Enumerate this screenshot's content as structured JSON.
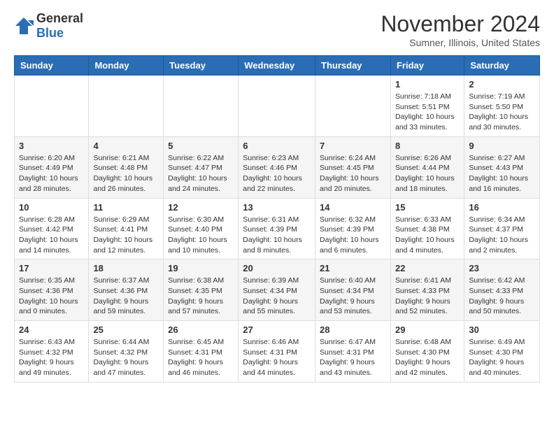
{
  "header": {
    "logo_general": "General",
    "logo_blue": "Blue",
    "month_title": "November 2024",
    "location": "Sumner, Illinois, United States"
  },
  "days_of_week": [
    "Sunday",
    "Monday",
    "Tuesday",
    "Wednesday",
    "Thursday",
    "Friday",
    "Saturday"
  ],
  "weeks": [
    [
      {
        "day": "",
        "info": ""
      },
      {
        "day": "",
        "info": ""
      },
      {
        "day": "",
        "info": ""
      },
      {
        "day": "",
        "info": ""
      },
      {
        "day": "",
        "info": ""
      },
      {
        "day": "1",
        "info": "Sunrise: 7:18 AM\nSunset: 5:51 PM\nDaylight: 10 hours and 33 minutes."
      },
      {
        "day": "2",
        "info": "Sunrise: 7:19 AM\nSunset: 5:50 PM\nDaylight: 10 hours and 30 minutes."
      }
    ],
    [
      {
        "day": "3",
        "info": "Sunrise: 6:20 AM\nSunset: 4:49 PM\nDaylight: 10 hours and 28 minutes."
      },
      {
        "day": "4",
        "info": "Sunrise: 6:21 AM\nSunset: 4:48 PM\nDaylight: 10 hours and 26 minutes."
      },
      {
        "day": "5",
        "info": "Sunrise: 6:22 AM\nSunset: 4:47 PM\nDaylight: 10 hours and 24 minutes."
      },
      {
        "day": "6",
        "info": "Sunrise: 6:23 AM\nSunset: 4:46 PM\nDaylight: 10 hours and 22 minutes."
      },
      {
        "day": "7",
        "info": "Sunrise: 6:24 AM\nSunset: 4:45 PM\nDaylight: 10 hours and 20 minutes."
      },
      {
        "day": "8",
        "info": "Sunrise: 6:26 AM\nSunset: 4:44 PM\nDaylight: 10 hours and 18 minutes."
      },
      {
        "day": "9",
        "info": "Sunrise: 6:27 AM\nSunset: 4:43 PM\nDaylight: 10 hours and 16 minutes."
      }
    ],
    [
      {
        "day": "10",
        "info": "Sunrise: 6:28 AM\nSunset: 4:42 PM\nDaylight: 10 hours and 14 minutes."
      },
      {
        "day": "11",
        "info": "Sunrise: 6:29 AM\nSunset: 4:41 PM\nDaylight: 10 hours and 12 minutes."
      },
      {
        "day": "12",
        "info": "Sunrise: 6:30 AM\nSunset: 4:40 PM\nDaylight: 10 hours and 10 minutes."
      },
      {
        "day": "13",
        "info": "Sunrise: 6:31 AM\nSunset: 4:39 PM\nDaylight: 10 hours and 8 minutes."
      },
      {
        "day": "14",
        "info": "Sunrise: 6:32 AM\nSunset: 4:39 PM\nDaylight: 10 hours and 6 minutes."
      },
      {
        "day": "15",
        "info": "Sunrise: 6:33 AM\nSunset: 4:38 PM\nDaylight: 10 hours and 4 minutes."
      },
      {
        "day": "16",
        "info": "Sunrise: 6:34 AM\nSunset: 4:37 PM\nDaylight: 10 hours and 2 minutes."
      }
    ],
    [
      {
        "day": "17",
        "info": "Sunrise: 6:35 AM\nSunset: 4:36 PM\nDaylight: 10 hours and 0 minutes."
      },
      {
        "day": "18",
        "info": "Sunrise: 6:37 AM\nSunset: 4:36 PM\nDaylight: 9 hours and 59 minutes."
      },
      {
        "day": "19",
        "info": "Sunrise: 6:38 AM\nSunset: 4:35 PM\nDaylight: 9 hours and 57 minutes."
      },
      {
        "day": "20",
        "info": "Sunrise: 6:39 AM\nSunset: 4:34 PM\nDaylight: 9 hours and 55 minutes."
      },
      {
        "day": "21",
        "info": "Sunrise: 6:40 AM\nSunset: 4:34 PM\nDaylight: 9 hours and 53 minutes."
      },
      {
        "day": "22",
        "info": "Sunrise: 6:41 AM\nSunset: 4:33 PM\nDaylight: 9 hours and 52 minutes."
      },
      {
        "day": "23",
        "info": "Sunrise: 6:42 AM\nSunset: 4:33 PM\nDaylight: 9 hours and 50 minutes."
      }
    ],
    [
      {
        "day": "24",
        "info": "Sunrise: 6:43 AM\nSunset: 4:32 PM\nDaylight: 9 hours and 49 minutes."
      },
      {
        "day": "25",
        "info": "Sunrise: 6:44 AM\nSunset: 4:32 PM\nDaylight: 9 hours and 47 minutes."
      },
      {
        "day": "26",
        "info": "Sunrise: 6:45 AM\nSunset: 4:31 PM\nDaylight: 9 hours and 46 minutes."
      },
      {
        "day": "27",
        "info": "Sunrise: 6:46 AM\nSunset: 4:31 PM\nDaylight: 9 hours and 44 minutes."
      },
      {
        "day": "28",
        "info": "Sunrise: 6:47 AM\nSunset: 4:31 PM\nDaylight: 9 hours and 43 minutes."
      },
      {
        "day": "29",
        "info": "Sunrise: 6:48 AM\nSunset: 4:30 PM\nDaylight: 9 hours and 42 minutes."
      },
      {
        "day": "30",
        "info": "Sunrise: 6:49 AM\nSunset: 4:30 PM\nDaylight: 9 hours and 40 minutes."
      }
    ]
  ]
}
